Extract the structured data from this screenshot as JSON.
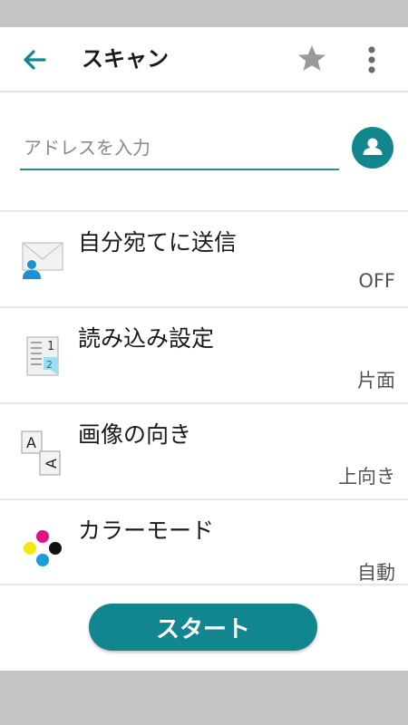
{
  "header": {
    "title": "スキャン",
    "back_icon": "arrow-left-icon",
    "favorite_icon": "star-icon",
    "more_icon": "more-vertical-icon"
  },
  "address": {
    "placeholder": "アドレスを入力",
    "value": "",
    "contact_icon": "person-icon"
  },
  "settings": [
    {
      "label": "自分宛てに送信",
      "value": "OFF",
      "icon": "envelope-person-icon"
    },
    {
      "label": "読み込み設定",
      "value": "片面",
      "icon": "document-pages-icon"
    },
    {
      "label": "画像の向き",
      "value": "上向き",
      "icon": "orientation-icon"
    },
    {
      "label": "カラーモード",
      "value": "自動",
      "icon": "color-dots-icon"
    }
  ],
  "footer": {
    "start_label": "スタート"
  },
  "colors": {
    "accent": "#12868e",
    "frame": "#c4c4c4",
    "star": "#9a9a9a"
  }
}
